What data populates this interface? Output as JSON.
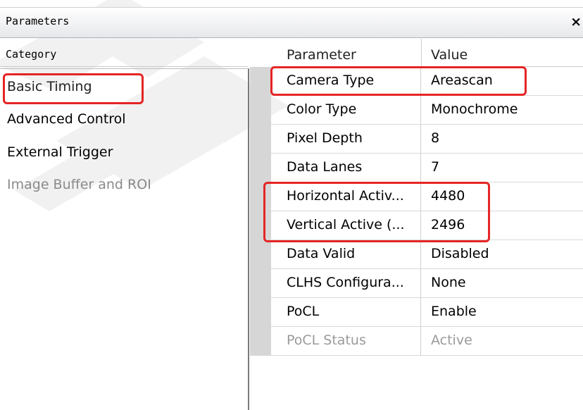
{
  "window": {
    "title": "Parameters",
    "close": "×"
  },
  "category": {
    "header": "Category",
    "items": [
      {
        "label": "Basic Timing"
      },
      {
        "label": "Advanced Control"
      },
      {
        "label": "External Trigger"
      },
      {
        "label": "Image Buffer and ROI"
      }
    ],
    "selected": "Basic Timing"
  },
  "grid": {
    "columns": {
      "parameter": "Parameter",
      "value": "Value"
    },
    "rows": [
      {
        "parameter": "Camera Type",
        "value": "Areascan"
      },
      {
        "parameter": "Color Type",
        "value": "Monochrome"
      },
      {
        "parameter": "Pixel Depth",
        "value": "8"
      },
      {
        "parameter": "Data Lanes",
        "value": "7"
      },
      {
        "parameter": "Horizontal Activ...",
        "value": "4480"
      },
      {
        "parameter": "Vertical Active (...",
        "value": "2496"
      },
      {
        "parameter": "Data Valid",
        "value": "Disabled"
      },
      {
        "parameter": "CLHS Configura...",
        "value": "None"
      },
      {
        "parameter": "PoCL",
        "value": "Enable"
      },
      {
        "parameter": "PoCL Status",
        "value": "Active"
      }
    ]
  },
  "colors": {
    "highlight": "#e52525",
    "gutter": "#d6d6d6",
    "dim_text": "#9a9a9a"
  }
}
